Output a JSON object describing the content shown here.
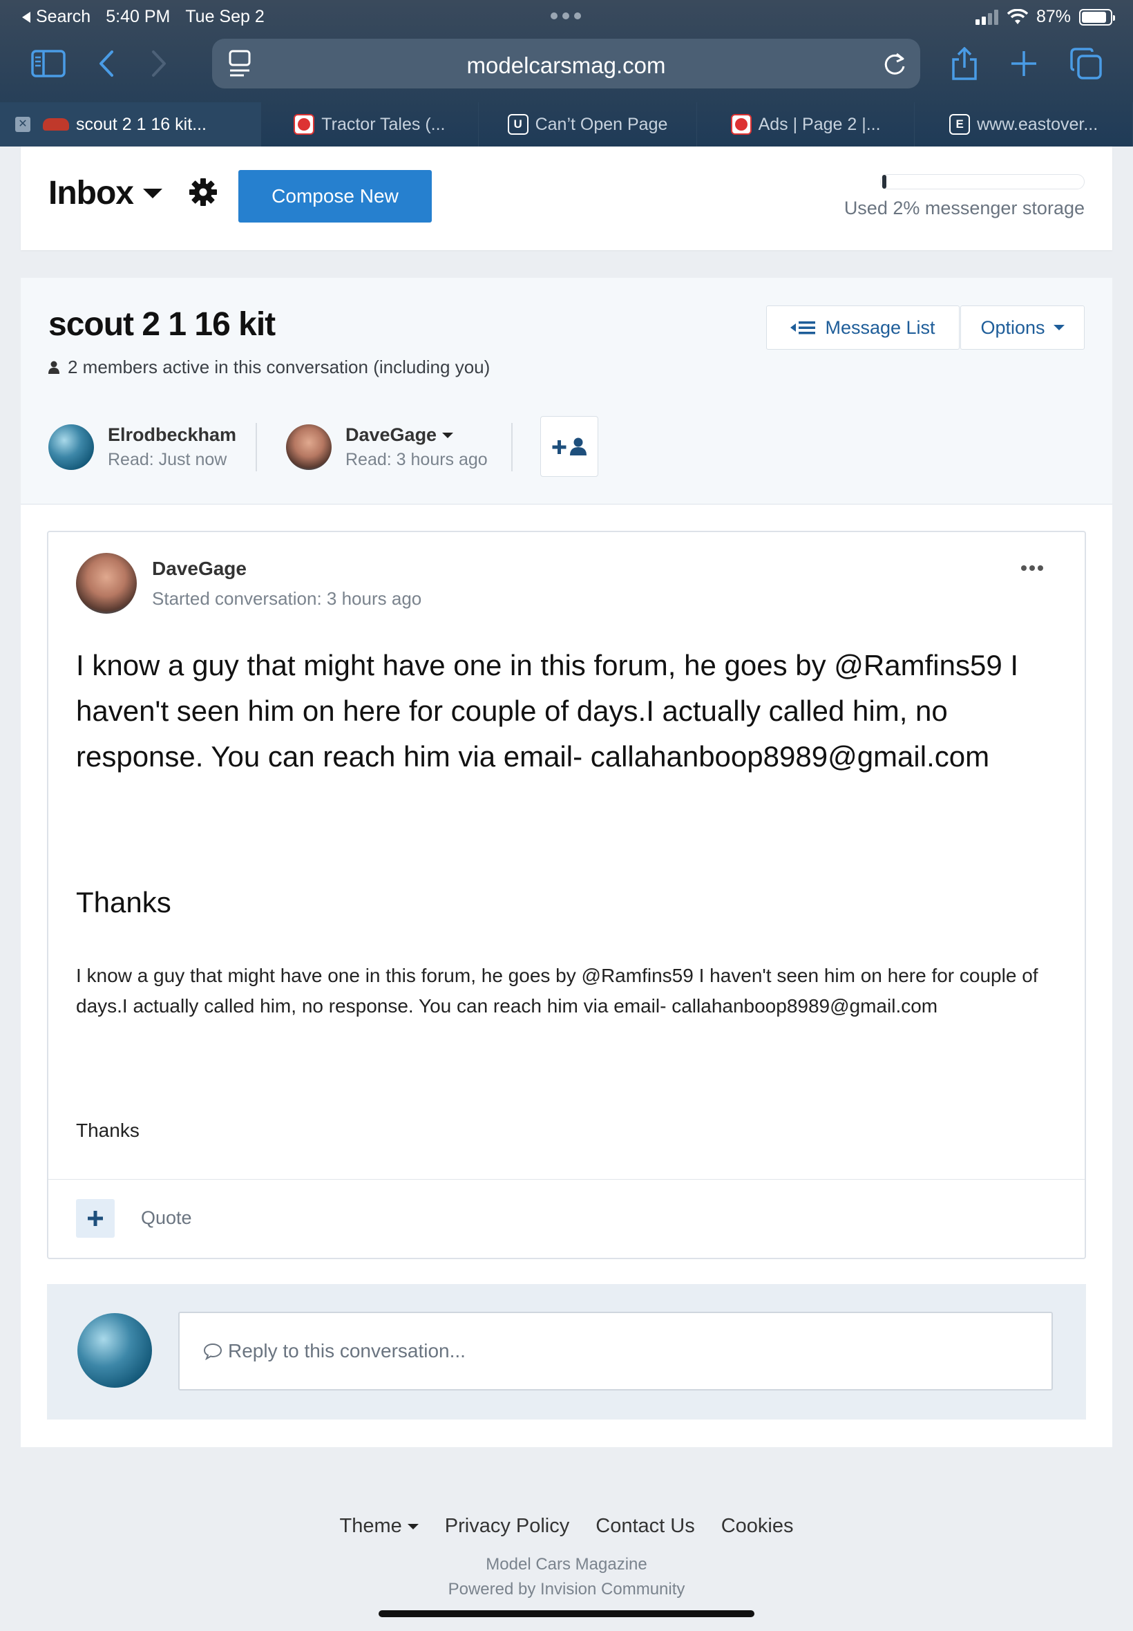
{
  "status_bar": {
    "back_label": "Search",
    "time": "5:40 PM",
    "date": "Tue Sep 2",
    "battery": "87%",
    "battery_level": 0.87
  },
  "browser": {
    "url": "modelcarsmag.com",
    "tabs": [
      {
        "label": "scout 2 1 16 kit...",
        "active": true
      },
      {
        "label": "Tractor Tales (..."
      },
      {
        "label": "Can’t Open Page",
        "favicon_letter": "U"
      },
      {
        "label": "Ads | Page 2 |..."
      },
      {
        "label": "www.eastover...",
        "favicon_letter": "E"
      }
    ]
  },
  "inbox": {
    "title": "Inbox",
    "compose_label": "Compose New",
    "storage_label": "Used 2% messenger storage",
    "storage_used": 0.02
  },
  "conversation": {
    "title": "scout 2 1 16 kit",
    "subtitle": "2 members active in this conversation (including you)",
    "message_list_label": "Message List",
    "options_label": "Options",
    "participants": [
      {
        "name": "Elrodbeckham",
        "read": "Read: Just now"
      },
      {
        "name": "DaveGage",
        "read": "Read: 3 hours ago"
      }
    ]
  },
  "post": {
    "author": "DaveGage",
    "meta": "Started conversation: 3 hours ago",
    "body_large": "I know a guy that might have one in this forum, he goes by @Ramfins59 I haven't seen him on here for couple of days.I actually called him, no response. You can reach him via email- callahanboop8989@gmail.com",
    "thanks_large": "Thanks",
    "body_small": "I know a guy that might have one in this forum, he goes by @Ramfins59 I haven't seen him on here for couple of days.I actually called him, no response. You can reach him via email- callahanboop8989@gmail.com",
    "thanks_small": "Thanks",
    "quote_label": "Quote"
  },
  "reply": {
    "placeholder": "Reply to this conversation..."
  },
  "footer": {
    "theme": "Theme",
    "privacy": "Privacy Policy",
    "contact": "Contact Us",
    "cookies": "Cookies",
    "site_name": "Model Cars Magazine",
    "powered_by": "Powered by Invision Community"
  },
  "colors": {
    "accent": "#2680cf",
    "link": "#1e5d99",
    "chrome": "#1f3b57"
  }
}
